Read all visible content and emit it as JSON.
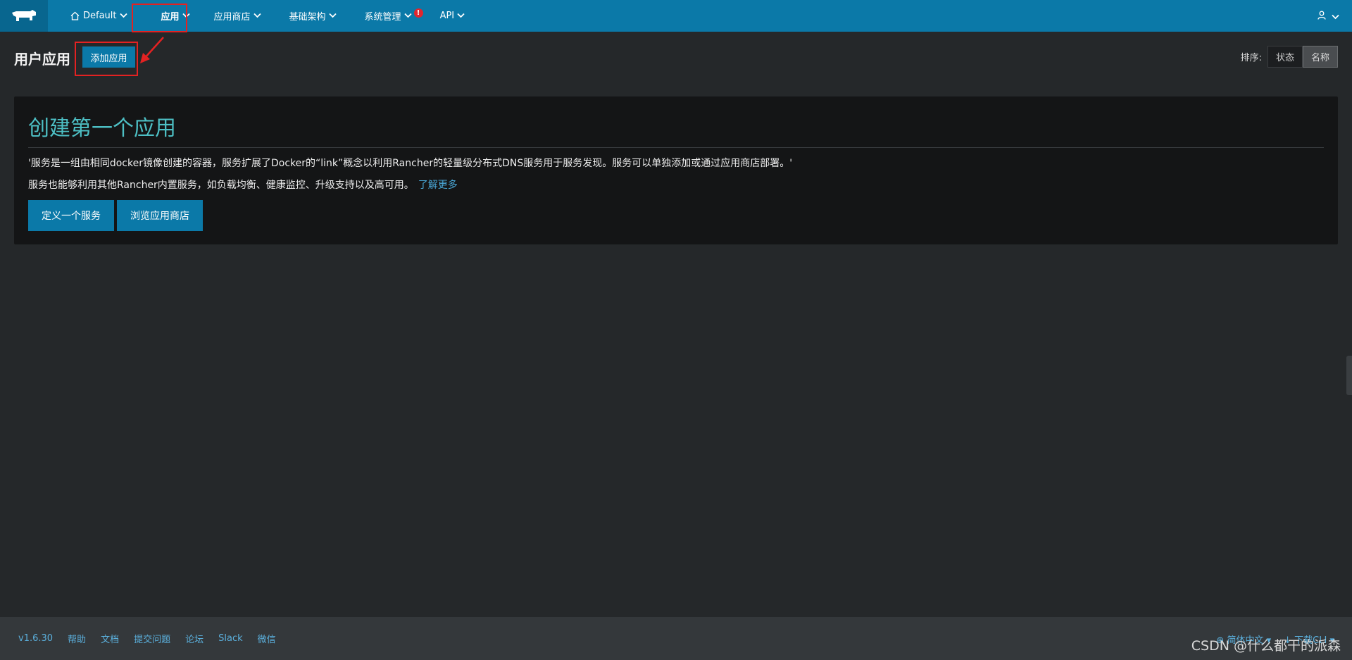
{
  "nav": {
    "environment": "Default",
    "items": [
      {
        "label": "应用"
      },
      {
        "label": "应用商店"
      },
      {
        "label": "基础架构"
      },
      {
        "label": "系统管理",
        "badge": "!"
      },
      {
        "label": "API"
      }
    ]
  },
  "header": {
    "title": "用户应用",
    "add_button": "添加应用",
    "sort_label": "排序:",
    "sort_options": [
      "状态",
      "名称"
    ],
    "sort_selected": "名称"
  },
  "panel": {
    "title": "创建第一个应用",
    "line1": "'服务是一组由相同docker镜像创建的容器，服务扩展了Docker的“link”概念以利用Rancher的轻量级分布式DNS服务用于服务发现。服务可以单独添加或通过应用商店部署。'",
    "line2": "服务也能够利用其他Rancher内置服务，如负载均衡、健康监控、升级支持以及高可用。",
    "learn_more": "了解更多",
    "define_service": "定义一个服务",
    "browse_catalog": "浏览应用商店"
  },
  "footer": {
    "version": "v1.6.30",
    "links": [
      "帮助",
      "文档",
      "提交问题",
      "论坛",
      "Slack",
      "微信"
    ],
    "language": "简体中文",
    "download_cli": "下载CLI"
  },
  "watermark": "CSDN @什么都干的派森",
  "colors": {
    "topbar": "#0b79a8",
    "accent_title": "#4dbfc4",
    "annotation": "#e32222"
  }
}
